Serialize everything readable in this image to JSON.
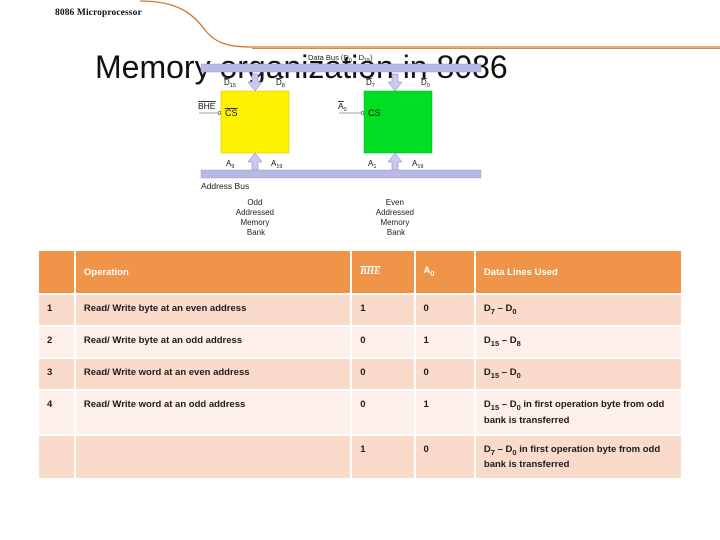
{
  "slide": {
    "header": "8086 Microprocessor",
    "title": "Memory organization in 8086"
  },
  "diagram": {
    "data_bus_label": "Data Bus (D",
    "data_bus_sub_lo": "0",
    "data_bus_sep": " - D",
    "data_bus_sub_hi": "15",
    "data_bus_close": ")",
    "address_bus_label": "Address Bus",
    "odd_bank": {
      "fill": "#FFF200",
      "data_hi": "D",
      "data_hi_sub": "15",
      "data_lo": "D",
      "data_lo_sub": "8",
      "cs_label": "CS",
      "enable_label": "BHE",
      "addr_lo": "A",
      "addr_lo_sub": "9",
      "addr_hi": "A",
      "addr_hi_sub": "19",
      "caption": [
        "Odd",
        "Addressed",
        "Memory",
        "Bank"
      ]
    },
    "even_bank": {
      "fill": "#00DD22",
      "data_hi": "D",
      "data_hi_sub": "7",
      "data_lo": "D",
      "data_lo_sub": "0",
      "cs_label": "CS",
      "enable_label": "A",
      "enable_sub": "0",
      "addr_lo": "A",
      "addr_lo_sub": "1",
      "addr_hi": "A",
      "addr_hi_sub": "19",
      "caption": [
        "Even",
        "Addressed",
        "Memory",
        "Bank"
      ]
    }
  },
  "table": {
    "header": {
      "index": "",
      "operation": "Operation",
      "bhe": "BHE",
      "a0": "A",
      "a0_sub": "0",
      "data_lines": "Data Lines Used"
    },
    "rows": [
      {
        "index": "1",
        "operation": "Read/ Write byte at an even address",
        "bhe": "1",
        "a0": "0",
        "data_lines_html": "D<sub>7</sub> &#8211; D<sub>0</sub>"
      },
      {
        "index": "2",
        "operation": "Read/ Write byte at an odd address",
        "bhe": "0",
        "a0": "1",
        "data_lines_html": "D<sub>15</sub> &#8211; D<sub>8</sub>"
      },
      {
        "index": "3",
        "operation": "Read/ Write word at an even address",
        "bhe": "0",
        "a0": "0",
        "data_lines_html": "D<sub>15</sub> &#8211; D<sub>0</sub>"
      },
      {
        "index": "4",
        "operation": "Read/ Write word at an odd address",
        "bhe": "0",
        "a0": "1",
        "data_lines_html": "D<sub>15</sub> &#8211; D<sub>0</sub> in first operation byte from odd bank is transferred"
      },
      {
        "index": "",
        "operation": "",
        "bhe": "1",
        "a0": "0",
        "data_lines_html": "D<sub>7</sub> &#8211; D<sub>0</sub> in first operation byte from odd bank is transferred"
      }
    ]
  },
  "colors": {
    "header_orange": "#F09449",
    "row_dark": "#FADBCB",
    "row_light": "#FDEFE9",
    "swoosh": "#D2772F",
    "bus_bar": "#B8B8E8"
  }
}
